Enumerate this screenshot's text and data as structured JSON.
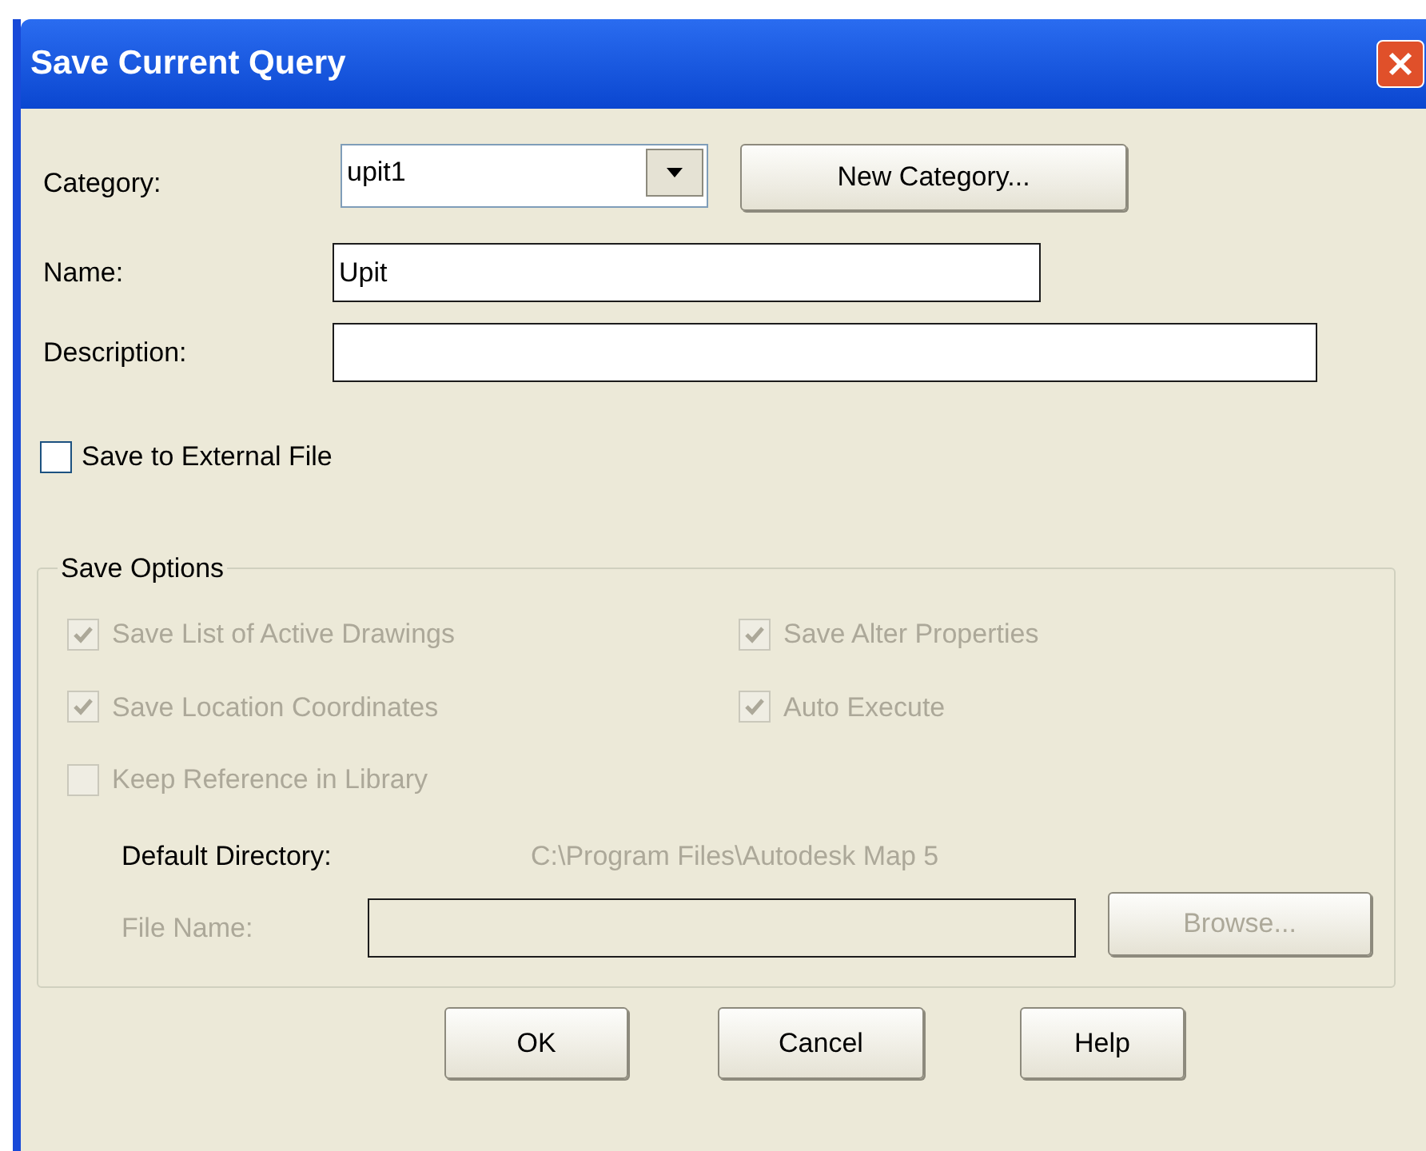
{
  "window": {
    "title": "Save Current Query"
  },
  "category": {
    "label": "Category:",
    "value": "upit1",
    "button": "New Category..."
  },
  "name": {
    "label": "Name:",
    "value": "Upit"
  },
  "description": {
    "label": "Description:"
  },
  "save_to_external_file": {
    "label": "Save to External File",
    "checked": false
  },
  "save_options": {
    "legend": "Save Options",
    "options": [
      {
        "label": "Save List of Active Drawings",
        "checked": true,
        "disabled": true
      },
      {
        "label": "Save Alter Properties",
        "checked": true,
        "disabled": true
      },
      {
        "label": "Save Location Coordinates",
        "checked": true,
        "disabled": true
      },
      {
        "label": "Auto Execute",
        "checked": true,
        "disabled": true
      },
      {
        "label": "Keep Reference in Library",
        "checked": false,
        "disabled": true
      }
    ],
    "default_directory": {
      "label": "Default Directory:",
      "value": "C:\\Program Files\\Autodesk Map 5"
    },
    "file_name": {
      "label": "File Name:",
      "disabled": true
    },
    "browse_button": {
      "label": "Browse...",
      "disabled": true
    }
  },
  "buttons": [
    "OK",
    "Cancel",
    "Help"
  ]
}
